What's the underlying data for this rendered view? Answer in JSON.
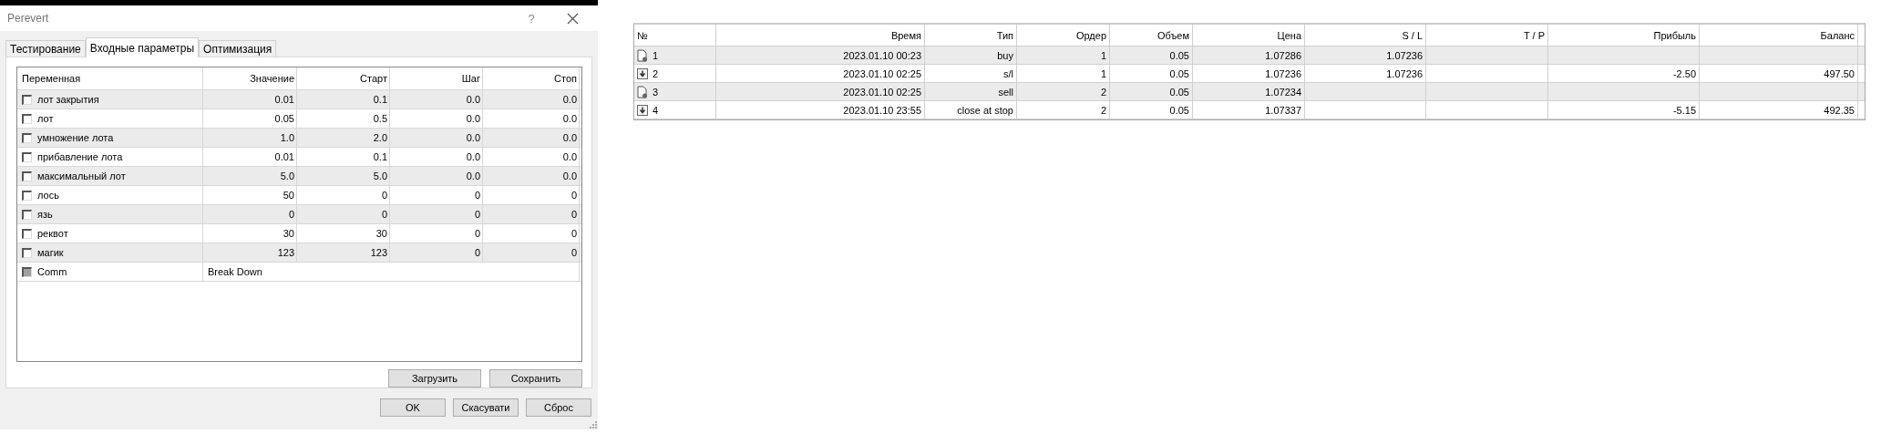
{
  "dialog": {
    "title": "Perevert",
    "help": "?",
    "tabs": [
      {
        "label": "Тестирование",
        "selected": false
      },
      {
        "label": "Входные параметры",
        "selected": true
      },
      {
        "label": "Оптимизация",
        "selected": false
      }
    ],
    "params": {
      "columns": [
        "Переменная",
        "Значение",
        "Старт",
        "Шаг",
        "Стоп"
      ],
      "rows": [
        {
          "checked": false,
          "disabled": false,
          "cells": [
            "лот закрытия",
            "0.01",
            "0.1",
            "0.0",
            "0.0"
          ]
        },
        {
          "checked": false,
          "disabled": false,
          "cells": [
            "лот",
            "0.05",
            "0.5",
            "0.0",
            "0.0"
          ]
        },
        {
          "checked": false,
          "disabled": false,
          "cells": [
            "умножение лота",
            "1.0",
            "2.0",
            "0.0",
            "0.0"
          ]
        },
        {
          "checked": false,
          "disabled": false,
          "cells": [
            "прибавление лота",
            "0.01",
            "0.1",
            "0.0",
            "0.0"
          ]
        },
        {
          "checked": false,
          "disabled": false,
          "cells": [
            "максимальный лот",
            "5.0",
            "5.0",
            "0.0",
            "0.0"
          ]
        },
        {
          "checked": false,
          "disabled": false,
          "cells": [
            "лось",
            "50",
            "0",
            "0",
            "0"
          ]
        },
        {
          "checked": false,
          "disabled": false,
          "cells": [
            "язь",
            "0",
            "0",
            "0",
            "0"
          ]
        },
        {
          "checked": false,
          "disabled": false,
          "cells": [
            "реквот",
            "30",
            "30",
            "0",
            "0"
          ]
        },
        {
          "checked": false,
          "disabled": false,
          "cells": [
            "магик",
            "123",
            "123",
            "0",
            "0"
          ]
        },
        {
          "checked": false,
          "disabled": true,
          "cells": [
            "Comm",
            "Break Down"
          ]
        }
      ]
    },
    "panel_buttons": [
      "Загрузить",
      "Сохранить"
    ],
    "buttons": [
      "OK",
      "Скасувати",
      "Сброс"
    ]
  },
  "trades": {
    "columns": [
      "№",
      "Время",
      "Тип",
      "Ордер",
      "Объем",
      "Цена",
      "S / L",
      "T / P",
      "Прибыль",
      "Баланс"
    ],
    "rows": [
      {
        "kind": "order",
        "cells": [
          "1",
          "2023.01.10 00:23",
          "buy",
          "1",
          "0.05",
          "1.07286",
          "1.07236",
          "",
          "",
          ""
        ]
      },
      {
        "kind": "deal",
        "cells": [
          "2",
          "2023.01.10 02:25",
          "s/l",
          "1",
          "0.05",
          "1.07236",
          "1.07236",
          "",
          "-2.50",
          "497.50"
        ]
      },
      {
        "kind": "order",
        "cells": [
          "3",
          "2023.01.10 02:25",
          "sell",
          "2",
          "0.05",
          "1.07234",
          "",
          "",
          "",
          ""
        ]
      },
      {
        "kind": "deal",
        "cells": [
          "4",
          "2023.01.10 23:55",
          "close at stop",
          "2",
          "0.05",
          "1.07337",
          "",
          "",
          "-5.15",
          "492.35"
        ]
      }
    ]
  }
}
